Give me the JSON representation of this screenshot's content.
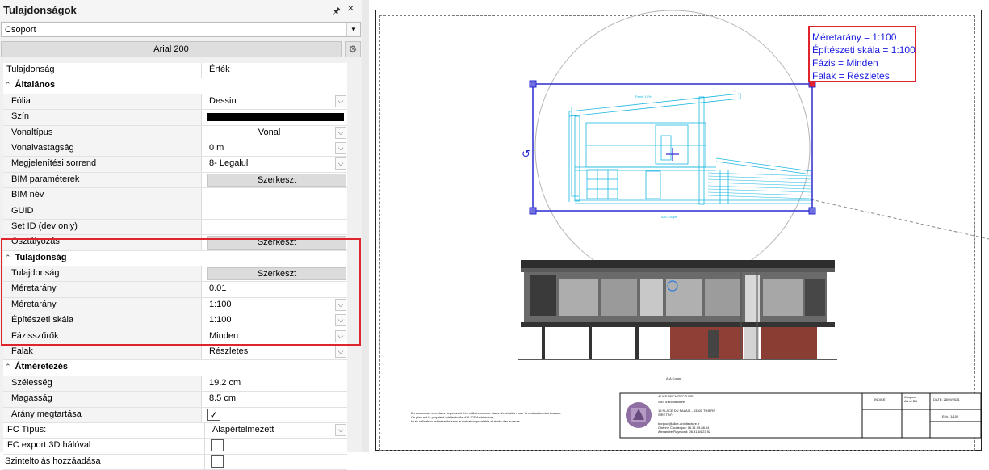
{
  "panel": {
    "title": "Tulajdonságok",
    "group_value": "Csoport",
    "font_button": "Arial 200",
    "header": {
      "col1": "Tulajdonság",
      "col2": "Érték"
    }
  },
  "general": {
    "category": "Általános",
    "folia_label": "Fólia",
    "folia_value": "Dessin",
    "szin_label": "Szín",
    "vonaltipus_label": "Vonaltípus",
    "vonaltipus_value": "Vonal",
    "vonalvastagsag_label": "Vonalvastagság",
    "vonalvastagsag_value": "0 m",
    "megjelenitesi_label": "Megjelenítési sorrend",
    "megjelenitesi_value": "8- Legalul",
    "bim_param_label": "BIM paraméterek",
    "bim_param_button": "Szerkeszt",
    "bim_nev_label": "BIM név",
    "guid_label": "GUID",
    "setid_label": "Set ID (dev only)",
    "osztalyozas_label": "Osztályozás",
    "osztalyozas_button": "Szerkeszt"
  },
  "property": {
    "category": "Tulajdonság",
    "tulajdonsag_label": "Tulajdonság",
    "tulajdonsag_button": "Szerkeszt",
    "meretarany_num_label": "Méretarány",
    "meretarany_num_value": "0.01",
    "meretarany_label": "Méretarány",
    "meretarany_value": "1:100",
    "epiteszeti_label": "Építészeti skála",
    "epiteszeti_value": "1:100",
    "fazis_label": "Fázisszűrők",
    "fazis_value": "Minden",
    "falak_label": "Falak",
    "falak_value": "Részletes"
  },
  "resize": {
    "category": "Átméretezés",
    "szelesseg_label": "Szélesség",
    "szelesseg_value": "19.2 cm",
    "magassag_label": "Magasság",
    "magassag_value": "8.5 cm",
    "arany_label": "Arány megtartása"
  },
  "ifc": {
    "tipus_label": "IFC Típus:",
    "tipus_value": "Alapértelmezett",
    "export_label": "IFC export 3D hálóval",
    "szint_label": "Szinteltolás hozzáadása"
  },
  "scale_info": {
    "line1": "Méretarány = 1:100",
    "line2": "Építészeti skála = 1:100",
    "line3": "Fázis = Minden",
    "line4": "Falak = Részletes"
  },
  "drawing": {
    "section_label_top": "A-A Coupe",
    "section_label_bottom": "A-A Coupe",
    "roof_label": "Pente 10%",
    "disclaimer_1": "En aucun cas ces plans ne peuvent être utilisés comme plans d'exécution pour la réalisation des travaux.",
    "disclaimer_2": "Ce plan est la propriété intellectuelle d'ALICE Architecture,",
    "disclaimer_3": "toute utilisation est interdite sans autorisation préalable et écrite des auteurs."
  },
  "title_block": {
    "company": "ALICE ARCHITECTURE",
    "company_sub": "SAS d'architecture",
    "address": "15 PLACE DU PALAIS - 63300 THIERS",
    "siret": "SIRET N°:",
    "email": "bonjour@alice-architecture.fr",
    "contact1": "Chérine Coudenjon: 06.31.09.88.64",
    "contact2": "Alexandre Raymond: 06.81.64.23.92",
    "indice": "INDICE",
    "coupes": "Coupes",
    "coupes_sub": "AA et BB",
    "date": "DATE: 28/09/2021",
    "echelle": "Ech.: 1/100"
  },
  "colors": {
    "accent_red": "#e0242c",
    "scale_text": "#1b1be0",
    "section_cyan": "#19b7e0",
    "selection_blue": "#2a2ad0"
  }
}
